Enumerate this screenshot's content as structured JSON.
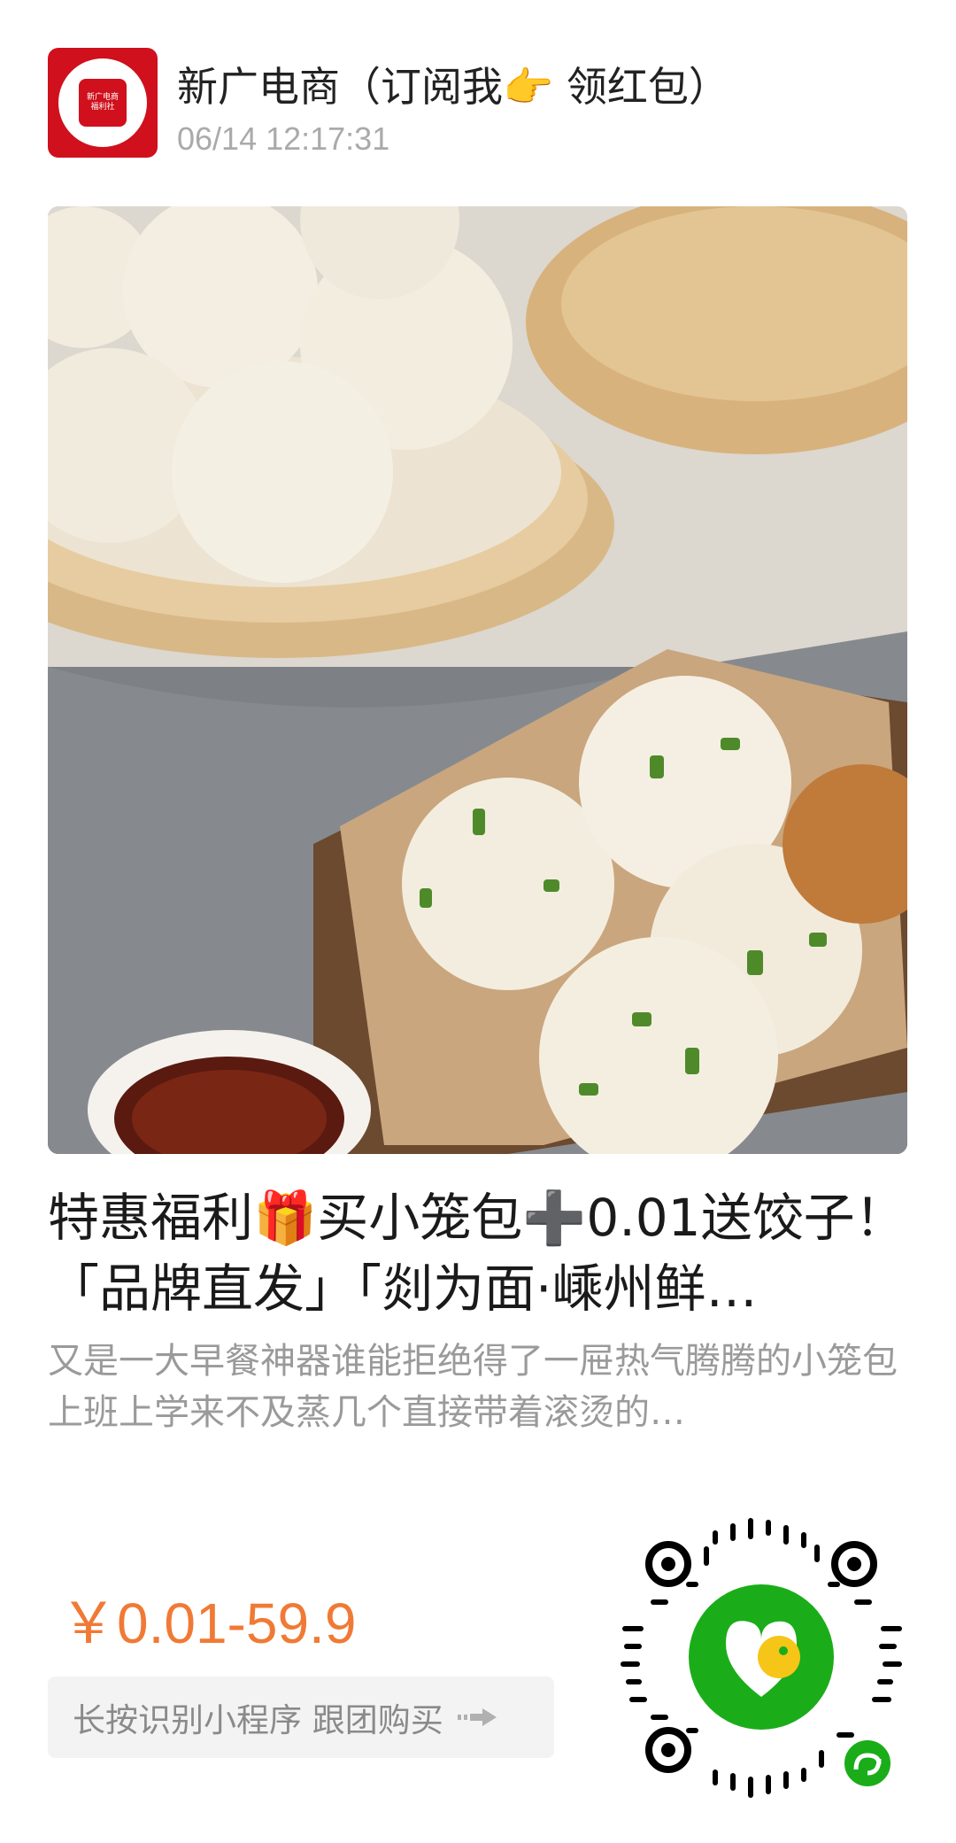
{
  "header": {
    "author": "新广电商（订阅我👉 领红包）",
    "timestamp": "06/14 12:17:31",
    "avatar_text": "新广电商\n福利社"
  },
  "post": {
    "title": "特惠福利🎁买小笼包➕0.01送饺子！「品牌直发」「剡为面·嵊州鲜…",
    "description": "又是一大早餐神器谁能拒绝得了一屉热气腾腾的小笼包上班上学来不及蒸几个直接带着滚烫的…",
    "image_icon": "buns-photo"
  },
  "price": {
    "text": "￥0.01-59.9"
  },
  "action": {
    "label": "长按识别小程序 跟团购买",
    "icon": "arrow-right-icon"
  },
  "qr": {
    "icon": "mini-program-qr"
  },
  "colors": {
    "price": "#f07a35",
    "qr_green": "#1aad19",
    "qr_yellow": "#f5c518",
    "avatar_red": "#d0101c"
  }
}
